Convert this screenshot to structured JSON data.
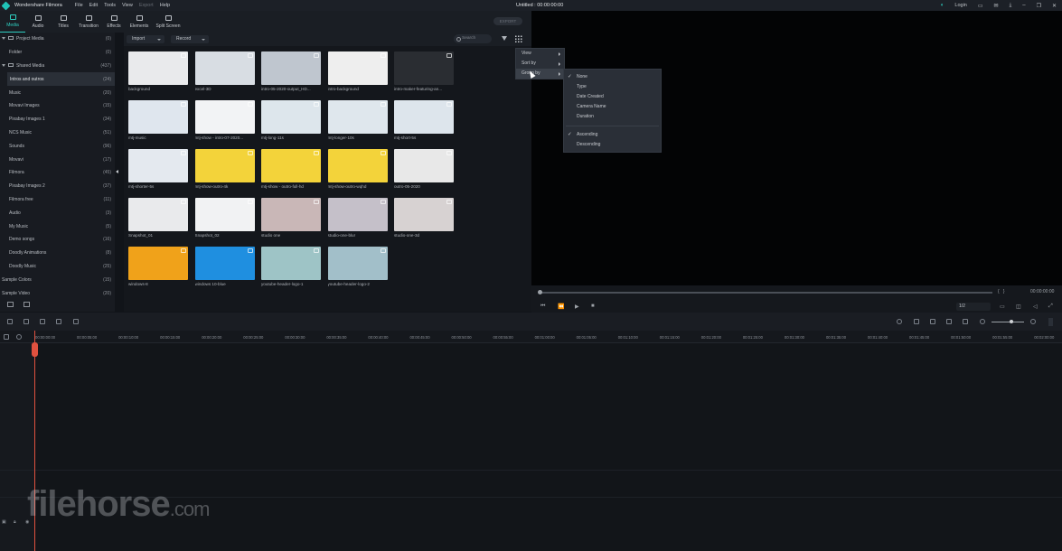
{
  "titlebar": {
    "app_name": "Wondershare Filmora",
    "menus": [
      "File",
      "Edit",
      "Tools",
      "View",
      "Export",
      "Help"
    ],
    "document": "Untitled : 00:00:00:00",
    "login": "Login"
  },
  "toolbar": {
    "tabs": [
      "Media",
      "Audio",
      "Titles",
      "Transition",
      "Effects",
      "Elements",
      "Split Screen"
    ],
    "export": "EXPORT"
  },
  "sidebar": {
    "items": [
      {
        "label": "Project Media",
        "count": "(0)"
      },
      {
        "label": "Folder",
        "count": "(0)"
      },
      {
        "label": "Shared Media",
        "count": "(437)"
      },
      {
        "label": "Intros and outros",
        "count": "(24)"
      },
      {
        "label": "Music",
        "count": "(20)"
      },
      {
        "label": "Movavi Images",
        "count": "(15)"
      },
      {
        "label": "Pixabay Images 1",
        "count": "(34)"
      },
      {
        "label": "NCS Music",
        "count": "(51)"
      },
      {
        "label": "Sounds",
        "count": "(96)"
      },
      {
        "label": "Movavi",
        "count": "(17)"
      },
      {
        "label": "Filmora",
        "count": "(45)"
      },
      {
        "label": "Pixabay Images 2",
        "count": "(37)"
      },
      {
        "label": "Filmora free",
        "count": "(11)"
      },
      {
        "label": "Audio",
        "count": "(3)"
      },
      {
        "label": "My Music",
        "count": "(5)"
      },
      {
        "label": "Demo songs",
        "count": "(16)"
      },
      {
        "label": "Doodly Animations",
        "count": "(8)"
      },
      {
        "label": "Doodly Music",
        "count": "(25)"
      },
      {
        "label": "Sample Colors",
        "count": "(15)"
      },
      {
        "label": "Sample Video",
        "count": "(20)"
      }
    ]
  },
  "mediabar": {
    "import": "Import",
    "record": "Record",
    "search_placeholder": "Search"
  },
  "media": [
    {
      "label": "background",
      "bg": "#e9eaec"
    },
    {
      "label": "excel-3D",
      "bg": "#d8dde3"
    },
    {
      "label": "intro-05-2020-output_HD...",
      "bg": "#bfc6cf"
    },
    {
      "label": "intro-background",
      "bg": "#eeeeee"
    },
    {
      "label": "intro-maker-featuring-an...",
      "bg": "#2a2d32"
    },
    {
      "label": "mtj-music",
      "bg": "#dfe6ee"
    },
    {
      "label": "mtj-show - intro-07-2020...",
      "bg": "#f2f3f5"
    },
    {
      "label": "mtj-long-11s",
      "bg": "#dde6ec"
    },
    {
      "label": "mtj-longer-10s",
      "bg": "#dfe7ed"
    },
    {
      "label": "mtj-short-5s",
      "bg": "#dde5ec"
    },
    {
      "label": "mtj-shorter-5s",
      "bg": "#e4e9ef"
    },
    {
      "label": "mtj-show-outro-4k",
      "bg": "#f3d33a"
    },
    {
      "label": "mtj-show - outro-full-hd",
      "bg": "#f3d33a"
    },
    {
      "label": "mtj-show-outro-wqhd",
      "bg": "#f3d33a"
    },
    {
      "label": "outro-05-2020",
      "bg": "#e8e8e8"
    },
    {
      "label": "Snapshot_01",
      "bg": "#e9eaec"
    },
    {
      "label": "Snapshot_02",
      "bg": "#f1f2f3"
    },
    {
      "label": "studio one",
      "bg": "#c9b7b7"
    },
    {
      "label": "studio-one-blur",
      "bg": "#c5c0c9"
    },
    {
      "label": "studio-one-3d",
      "bg": "#d7d2d2"
    },
    {
      "label": "windows-8",
      "bg": "#f0a21a"
    },
    {
      "label": "windows 10-blue",
      "bg": "#1f8fe0"
    },
    {
      "label": "youtube-header-logo-1",
      "bg": "#9ec4c6"
    },
    {
      "label": "youtube-header-logo-2",
      "bg": "#a2bfc9"
    }
  ],
  "context_menu": {
    "items": [
      "View",
      "Sort by",
      "Group by"
    ]
  },
  "submenu": {
    "items": [
      "None",
      "Type",
      "Date Created",
      "Camera Name",
      "Duration"
    ],
    "order": [
      "Ascending",
      "Descending"
    ]
  },
  "player": {
    "time": "00:00:00:00",
    "ratio": "1/2"
  },
  "timeline": {
    "ticks": [
      "00:00:00:00",
      "00:00:05:00",
      "00:00:10:00",
      "00:00:15:00",
      "00:00:20:00",
      "00:00:25:00",
      "00:00:30:00",
      "00:00:35:00",
      "00:00:40:00",
      "00:00:45:00",
      "00:00:50:00",
      "00:00:55:00",
      "00:01:00:00",
      "00:01:05:00",
      "00:01:10:00",
      "00:01:15:00",
      "00:01:20:00",
      "00:01:25:00",
      "00:01:30:00",
      "00:01:35:00",
      "00:01:40:00",
      "00:01:45:00",
      "00:01:50:00",
      "00:01:55:00",
      "00:02:00:00"
    ]
  },
  "watermark": {
    "text": "filehorse",
    "suffix": ".com"
  }
}
